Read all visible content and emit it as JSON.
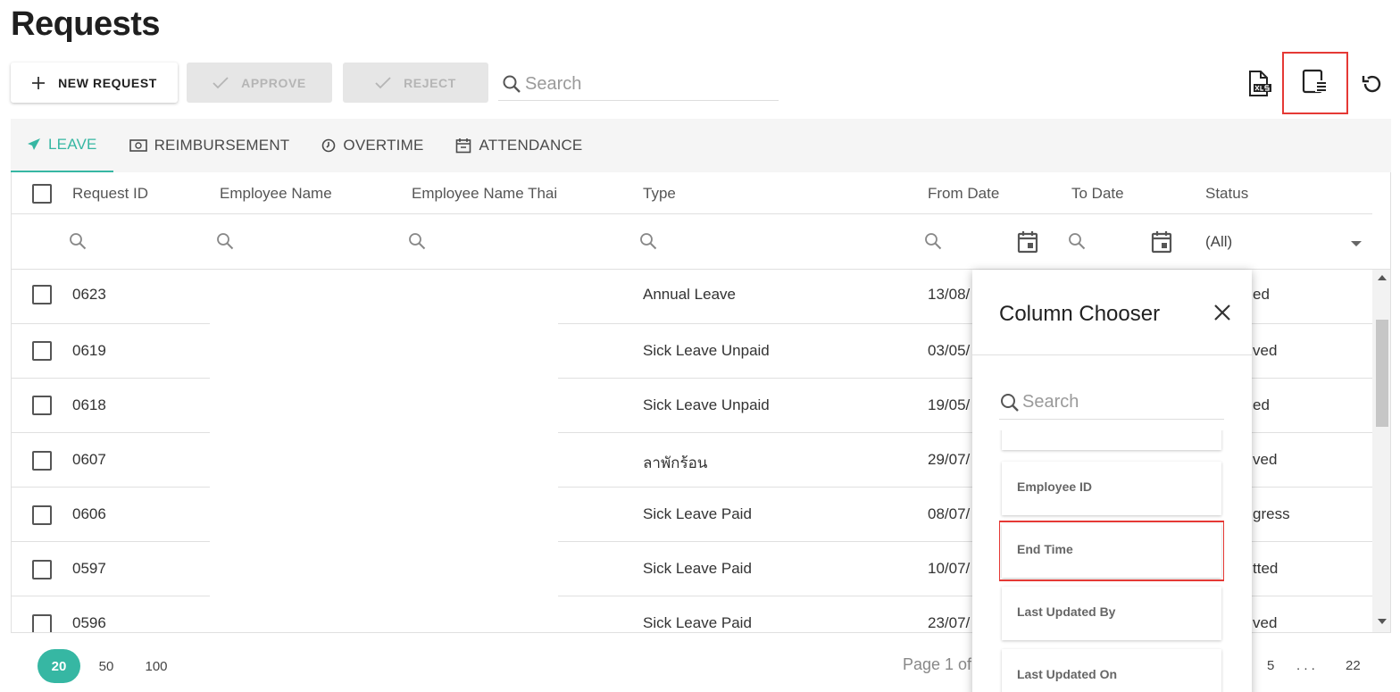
{
  "page": {
    "title": "Requests"
  },
  "toolbar": {
    "new_label": "NEW REQUEST",
    "approve_label": "APPROVE",
    "reject_label": "REJECT",
    "search_placeholder": "Search"
  },
  "icons": {
    "export": "xls-file-icon",
    "column_chooser": "column-chooser-icon",
    "refresh": "refresh-icon"
  },
  "tabs": [
    {
      "label": "LEAVE",
      "icon": "airplane-icon",
      "active": true
    },
    {
      "label": "REIMBURSEMENT",
      "icon": "money-icon",
      "active": false
    },
    {
      "label": "OVERTIME",
      "icon": "clock-icon",
      "active": false
    },
    {
      "label": "ATTENDANCE",
      "icon": "calendar-icon",
      "active": false
    }
  ],
  "grid": {
    "columns": [
      "Request ID",
      "Employee Name",
      "Employee Name Thai",
      "Type",
      "From Date",
      "To Date",
      "Status"
    ],
    "status_filter": "(All)",
    "rows": [
      {
        "id": "0623",
        "type": "Annual Leave",
        "from": "13/08/",
        "status": "ed"
      },
      {
        "id": "0619",
        "type": "Sick Leave Unpaid",
        "from": "03/05/",
        "status": "ved"
      },
      {
        "id": "0618",
        "type": "Sick Leave Unpaid",
        "from": "19/05/",
        "status": "ed"
      },
      {
        "id": "0607",
        "type": "ลาพักร้อน",
        "from": "29/07/",
        "status": "ved"
      },
      {
        "id": "0606",
        "type": "Sick Leave Paid",
        "from": "08/07/",
        "status": "gress"
      },
      {
        "id": "0597",
        "type": "Sick Leave Paid",
        "from": "10/07/",
        "status": "tted"
      },
      {
        "id": "0596",
        "type": "Sick Leave Paid",
        "from": "23/07/",
        "status": "ved"
      }
    ]
  },
  "pager": {
    "sizes": [
      "20",
      "50",
      "100"
    ],
    "active_size": "20",
    "page_info": "Page 1 of",
    "pages": [
      "5",
      ". . .",
      "22"
    ]
  },
  "column_chooser": {
    "title": "Column Chooser",
    "search_placeholder": "Search",
    "items": [
      "Employee ID",
      "End Time",
      "Last Updated By",
      "Last Updated On"
    ]
  },
  "colors": {
    "accent": "#36b7a3",
    "highlight": "#e53935"
  }
}
